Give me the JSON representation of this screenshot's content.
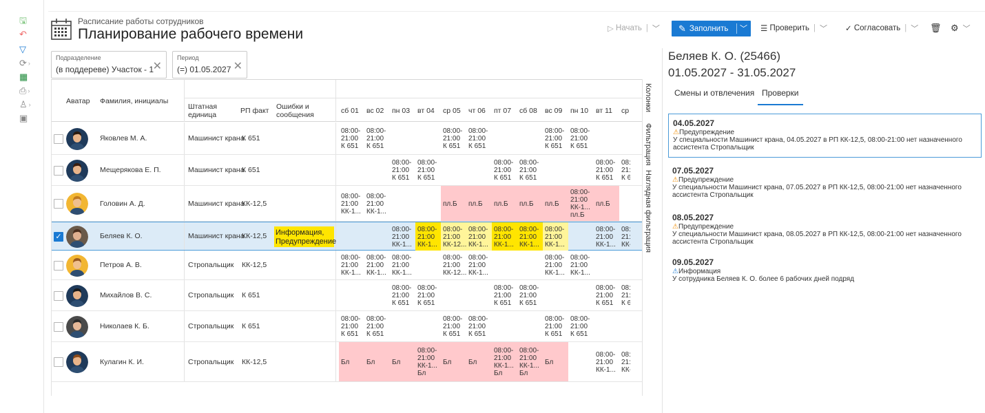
{
  "header": {
    "subtitle": "Расписание работы сотрудников",
    "title": "Планирование рабочего времени"
  },
  "toolbar": {
    "start": "Начать",
    "fill": "Заполнить",
    "check": "Проверить",
    "approve": "Согласовать"
  },
  "filters": [
    {
      "label": "Подразделение",
      "value": "(в поддереве) Участок - 1"
    },
    {
      "label": "Период",
      "value": "(=) 01.05.2027"
    }
  ],
  "table": {
    "columns": {
      "avatar": "Аватар",
      "name": "Фамилия, инициалы",
      "position": "Штатная единица",
      "rp": "РП факт",
      "errors": "Ошибки и сообщения"
    },
    "days": [
      "сб 01",
      "вс 02",
      "пн 03",
      "вт 04",
      "ср 05",
      "чт 06",
      "пт 07",
      "сб 08",
      "вс 09",
      "пн 10",
      "вт 11",
      "ср"
    ],
    "rows": [
      {
        "name": "Яковлев М. А.",
        "position": "Машинист крана",
        "rp": "К 651",
        "errors": "",
        "checked": false,
        "shifts": [
          "08:00-\n21:00\nК 651",
          "08:00-\n21:00\nК 651",
          "",
          "",
          "08:00-\n21:00\nК 651",
          "08:00-\n21:00\nК 651",
          "",
          "",
          "08:00-\n21:00\nК 651",
          "08:00-\n21:00\nК 651",
          "",
          ""
        ]
      },
      {
        "name": "Мещерякова Е. П.",
        "position": "Машинист крана",
        "rp": "К 651",
        "errors": "",
        "checked": false,
        "shifts": [
          "",
          "",
          "08:00-\n21:00\nК 651",
          "08:00-\n21:00\nК 651",
          "",
          "",
          "08:00-\n21:00\nК 651",
          "08:00-\n21:00\nК 651",
          "",
          "",
          "08:00-\n21:00\nК 651",
          "08:\n21:\nК 6"
        ]
      },
      {
        "name": "Головин А. Д.",
        "position": "Машинист крана",
        "rp": "КК-12,5",
        "errors": "",
        "checked": false,
        "shifts": [
          "08:00-\n21:00\nКК-1...",
          "08:00-\n21:00\nКК-1...",
          "",
          "",
          "пл.Б",
          "пл.Б",
          "пл.Б",
          "пл.Б",
          "пл.Б",
          "08:00-\n21:00\nКК-1...\nпл.Б",
          "пл.Б",
          ""
        ]
      },
      {
        "name": "Беляев К. О.",
        "position": "Машинист крана",
        "rp": "КК-12,5",
        "errors": "Информация,\nПредупреждение",
        "checked": true,
        "shifts": [
          "",
          "",
          "08:00-\n21:00\nКК-1...",
          "08:00-\n21:00\nКК-1...",
          "08:00-\n21:00\nКК-12...",
          "08:00-\n21:00\nКК-1...",
          "08:00-\n21:00\nКК-1...",
          "08:00-\n21:00\nКК-1...",
          "08:00-\n21:00\nКК-1...",
          "",
          "08:00-\n21:00\nКК-1...",
          "08:\n21:\nКК-"
        ]
      },
      {
        "name": "Петров А. В.",
        "position": "Стропальщик",
        "rp": "КК-12,5",
        "errors": "",
        "checked": false,
        "shifts": [
          "08:00-\n21:00\nКК-1...",
          "08:00-\n21:00\nКК-1...",
          "08:00-\n21:00\nКК-1...",
          "",
          "08:00-\n21:00\nКК-12...",
          "08:00-\n21:00\nКК-1...",
          "",
          "",
          "08:00-\n21:00\nКК-1...",
          "08:00-\n21:00\nКК-1...",
          "",
          ""
        ]
      },
      {
        "name": "Михайлов В. С.",
        "position": "Стропальщик",
        "rp": "К 651",
        "errors": "",
        "checked": false,
        "shifts": [
          "",
          "",
          "08:00-\n21:00\nК 651",
          "08:00-\n21:00\nК 651",
          "",
          "",
          "08:00-\n21:00\nК 651",
          "08:00-\n21:00\nК 651",
          "",
          "",
          "08:00-\n21:00\nК 651",
          "08:\n21:\nК 6"
        ]
      },
      {
        "name": "Николаев К. Б.",
        "position": "Стропальщик",
        "rp": "К 651",
        "errors": "",
        "checked": false,
        "shifts": [
          "08:00-\n21:00\nК 651",
          "08:00-\n21:00\nК 651",
          "",
          "",
          "08:00-\n21:00\nК 651",
          "08:00-\n21:00\nК 651",
          "",
          "",
          "08:00-\n21:00\nК 651",
          "08:00-\n21:00\nК 651",
          "",
          ""
        ]
      },
      {
        "name": "Кулагин К. И.",
        "position": "Стропальщик",
        "rp": "КК-12,5",
        "errors": "",
        "checked": false,
        "shifts": [
          "Бл",
          "Бл",
          "Бл",
          "08:00-\n21:00\nКК-1...\nБл",
          "Бл",
          "Бл",
          "08:00-\n21:00\nКК-1...\nБл",
          "08:00-\n21:00\nКК-1...\nБл",
          "Бл",
          "",
          "08:00-\n21:00\nКК-1...",
          "08:\n21:\nКК-"
        ]
      }
    ]
  },
  "side_panel": {
    "columns": "Колонки",
    "filtering": "Фильтрация",
    "visual_filtering": "Наглядная фильтрация"
  },
  "details": {
    "employee": "Беляев К. О. (25466)",
    "period": "01.05.2027 - 31.05.2027",
    "tabs": [
      "Смены и отвлечения",
      "Проверки"
    ],
    "issues": [
      {
        "date": "04.05.2027",
        "type": "Предупреждение",
        "text": "У специальности Машинист крана, 04.05.2027 в РП КК-12,5, 08:00-21:00 нет назначенного ассистента Стропальщик"
      },
      {
        "date": "07.05.2027",
        "type": "Предупреждение",
        "text": "У специальности Машинист крана, 07.05.2027 в РП КК-12,5, 08:00-21:00 нет назначенного ассистента Стропальщик"
      },
      {
        "date": "08.05.2027",
        "type": "Предупреждение",
        "text": "У специальности Машинист крана, 08.05.2027 в РП КК-12,5, 08:00-21:00 нет назначенного ассистента Стропальщик"
      },
      {
        "date": "09.05.2027",
        "type": "Информация",
        "text": "У сотрудника Беляев К. О. более 6 рабочих дней подряд"
      }
    ]
  },
  "colors": {
    "accent": "#1a7ad3",
    "sick": "#ffc9cc",
    "highlight": "#ffe500",
    "shift_yellow": "#fff59a",
    "selected_row": "#dcebf7"
  }
}
